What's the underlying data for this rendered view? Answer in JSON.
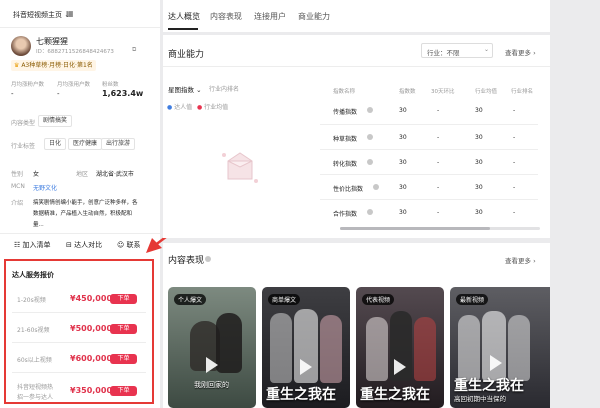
{
  "profile": {
    "account_switch": "抖音短视频主页",
    "name": "七颗猩猩",
    "id": "ID：6882711526848424673",
    "rank_badge": "A3种草榜·月榜·日化·第1名",
    "stats": [
      {
        "label": "月均涨粉户数",
        "value": "-"
      },
      {
        "label": "月均涨用户数",
        "value": "-"
      },
      {
        "label": "粉丝数",
        "value": "1,623.4w"
      }
    ],
    "content_type_label": "内容类型",
    "content_type_tag": "剧情搞笑",
    "industry_label": "行业标签",
    "industry_tags": [
      "日化",
      "医疗健康",
      "出行旅游"
    ],
    "gender_label": "性别",
    "gender": "女",
    "region_label": "地区",
    "region": "湖北省·武汉市",
    "mcn_label": "MCN",
    "mcn": "无野文化",
    "intro_label": "介绍",
    "intro_lines": [
      "搞笑剧情创编小能手，创意广泛种多样，各",
      "数据精准，产品植入生动自然，积极配和",
      "量..."
    ],
    "actions": {
      "add_list": "加入清单",
      "compare": "达人对比",
      "contact": "联系"
    }
  },
  "pricing": {
    "title": "达人服务报价",
    "items": [
      {
        "label": "1-20s视频",
        "price": "¥450,000",
        "button": "下单"
      },
      {
        "label": "21-60s视频",
        "price": "¥500,000",
        "button": "下单"
      },
      {
        "label": "60s以上视频",
        "price": "¥600,000",
        "button": "下单"
      },
      {
        "label": "抖音短视频热",
        "label2": "招一参与达人",
        "price": "¥350,000",
        "button": "下单"
      }
    ]
  },
  "tabs": [
    "达人概览",
    "内容表现",
    "连接用户",
    "商业能力"
  ],
  "business": {
    "title": "商业能力",
    "industry_label": "行业：",
    "industry_value": "不限",
    "more": "查看更多",
    "radar_tab": "星图指数",
    "radar_tab2": "行业内排名",
    "legend": [
      "达人值",
      "行业均值"
    ],
    "table_headers": [
      "指数名称",
      "指数数",
      "30天环比",
      "行业均值",
      "行业排名"
    ],
    "rows": [
      {
        "name": "传播指数",
        "value": "30",
        "mom": "-",
        "avg": "30",
        "rank": "-"
      },
      {
        "name": "种草指数",
        "value": "30",
        "mom": "-",
        "avg": "30",
        "rank": "-"
      },
      {
        "name": "转化指数",
        "value": "30",
        "mom": "-",
        "avg": "30",
        "rank": "-"
      },
      {
        "name": "性价比指数",
        "value": "30",
        "mom": "-",
        "avg": "30",
        "rank": "-"
      },
      {
        "name": "合作指数",
        "value": "30",
        "mom": "-",
        "avg": "30",
        "rank": "-"
      }
    ]
  },
  "content": {
    "title": "内容表现",
    "more": "查看更多",
    "cards": [
      {
        "badge": "个人爆文",
        "caption": "我刚回家的",
        "colors": [
          "#6b7a70",
          "#3d4a42"
        ]
      },
      {
        "badge": "商单爆文",
        "caption": "重生之我在",
        "colors": [
          "#3a3a3e",
          "#1c1c20"
        ]
      },
      {
        "badge": "代表视频",
        "caption": "重生之我在",
        "colors": [
          "#4a4045",
          "#221c20"
        ]
      },
      {
        "badge": "最新视频",
        "caption": "重生之我在",
        "caption2": "高回初期中当保的",
        "colors": [
          "#55555a",
          "#2a2a30"
        ]
      }
    ]
  },
  "colors": {
    "accent": "#e8334f",
    "annotation": "#e53935"
  }
}
